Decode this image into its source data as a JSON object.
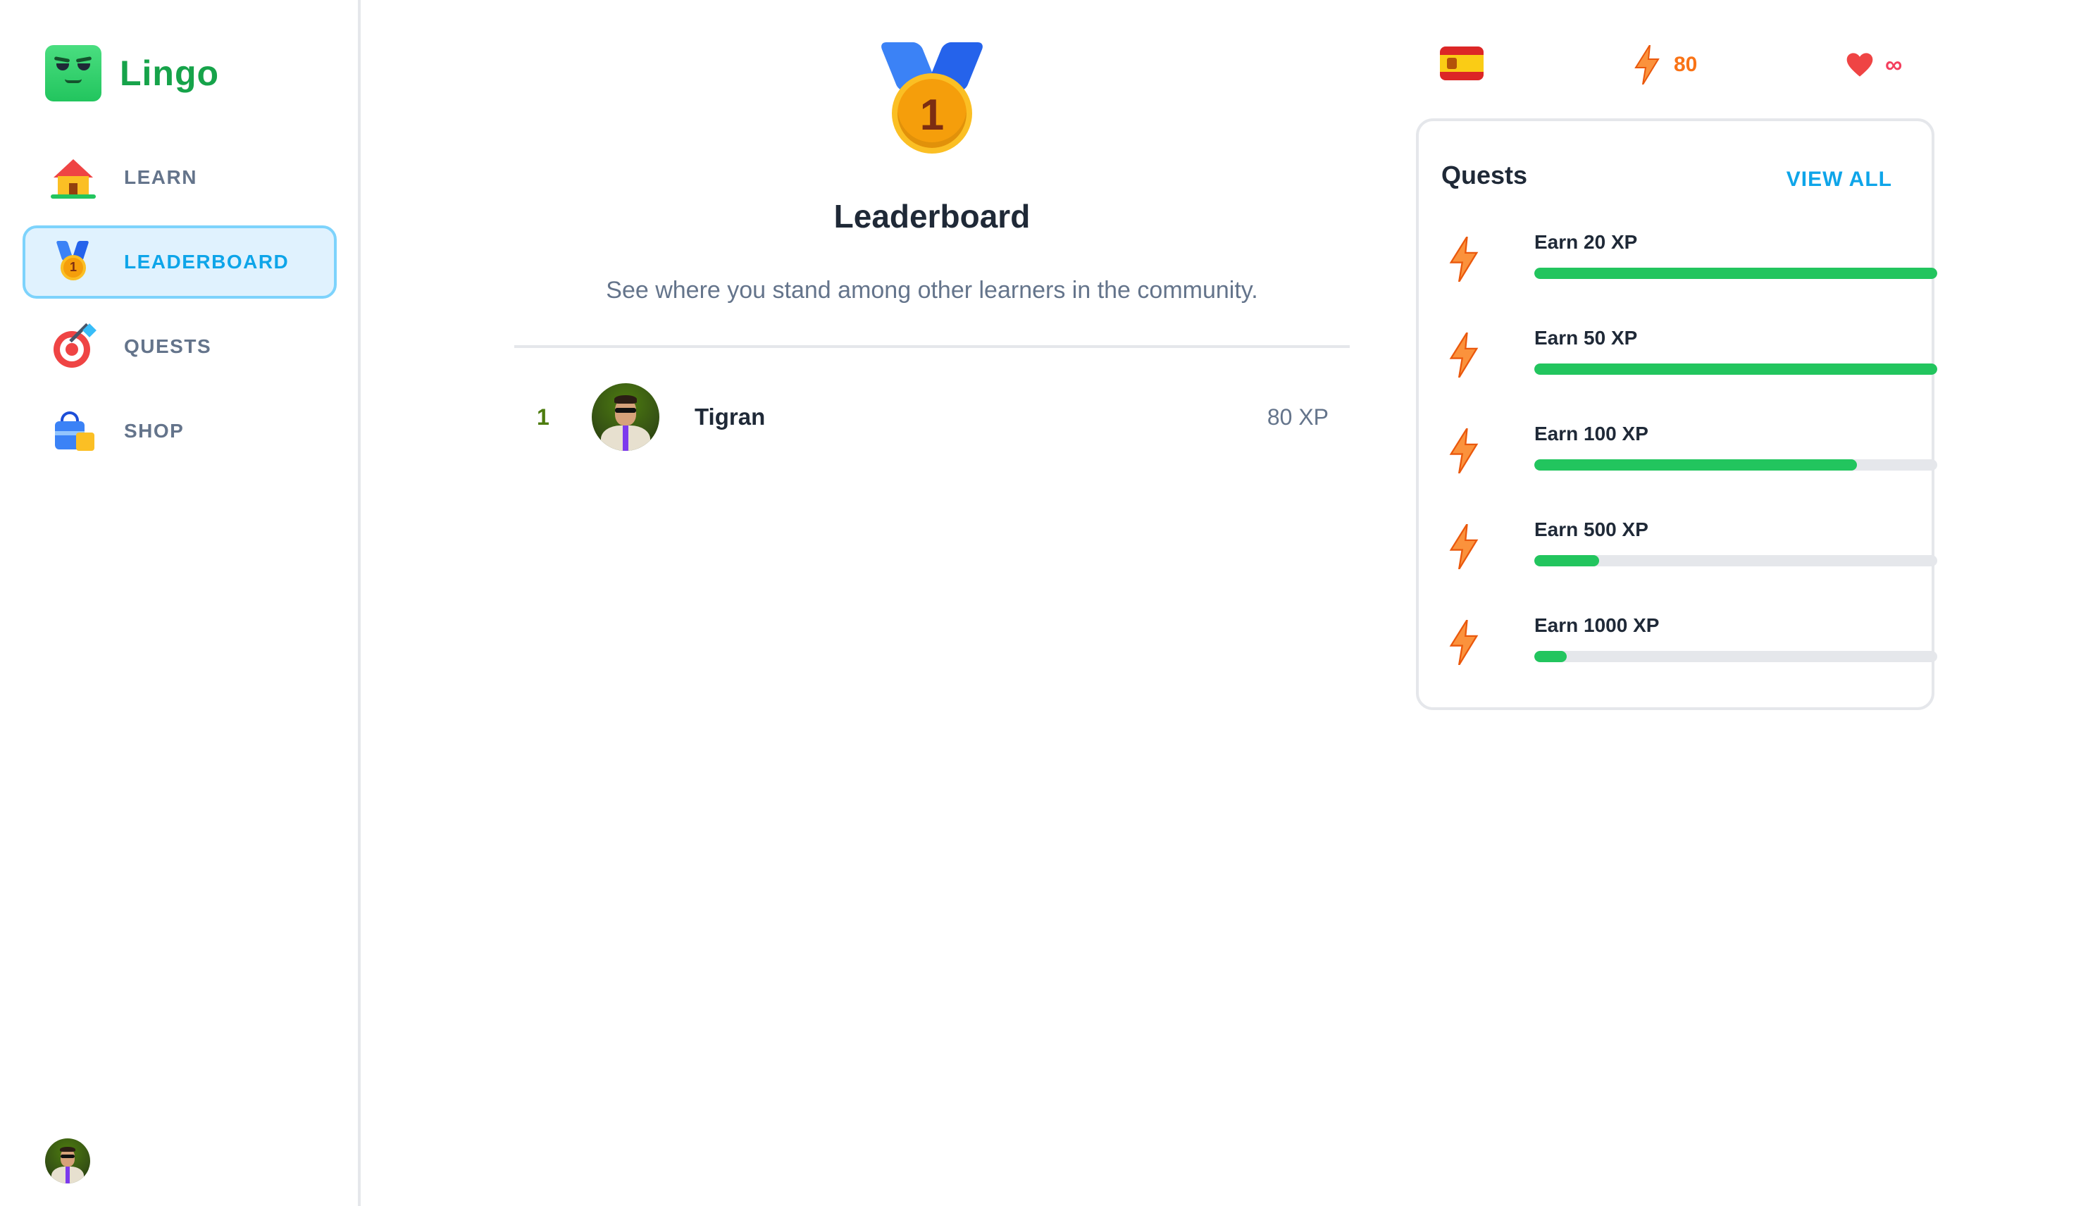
{
  "brand": {
    "name": "Lingo"
  },
  "nav": {
    "items": [
      {
        "label": "LEARN",
        "icon": "house-icon",
        "active": false
      },
      {
        "label": "LEADERBOARD",
        "icon": "medal-icon",
        "active": true
      },
      {
        "label": "QUESTS",
        "icon": "target-icon",
        "active": false
      },
      {
        "label": "SHOP",
        "icon": "shopping-bag-icon",
        "active": false
      }
    ]
  },
  "leaderboard": {
    "medal_number": "1",
    "title": "Leaderboard",
    "subtitle": "See where you stand among other learners in the community.",
    "entries": [
      {
        "rank": "1",
        "name": "Tigran",
        "xp": "80 XP"
      }
    ]
  },
  "stats": {
    "language_flag": "spain-flag-icon",
    "streak_value": "80",
    "hearts_value": "∞"
  },
  "quests": {
    "title": "Quests",
    "view_all_label": "VIEW ALL",
    "items": [
      {
        "label": "Earn 20 XP",
        "progress": 1.0
      },
      {
        "label": "Earn 50 XP",
        "progress": 1.0
      },
      {
        "label": "Earn 100 XP",
        "progress": 0.8
      },
      {
        "label": "Earn 500 XP",
        "progress": 0.16
      },
      {
        "label": "Earn 1000 XP",
        "progress": 0.08
      }
    ]
  },
  "colors": {
    "brand_green": "#16a34a",
    "active_blue": "#0ea5e9",
    "progress_green": "#22c55e",
    "streak_orange": "#f97316",
    "heart_red": "#f43f5e"
  }
}
